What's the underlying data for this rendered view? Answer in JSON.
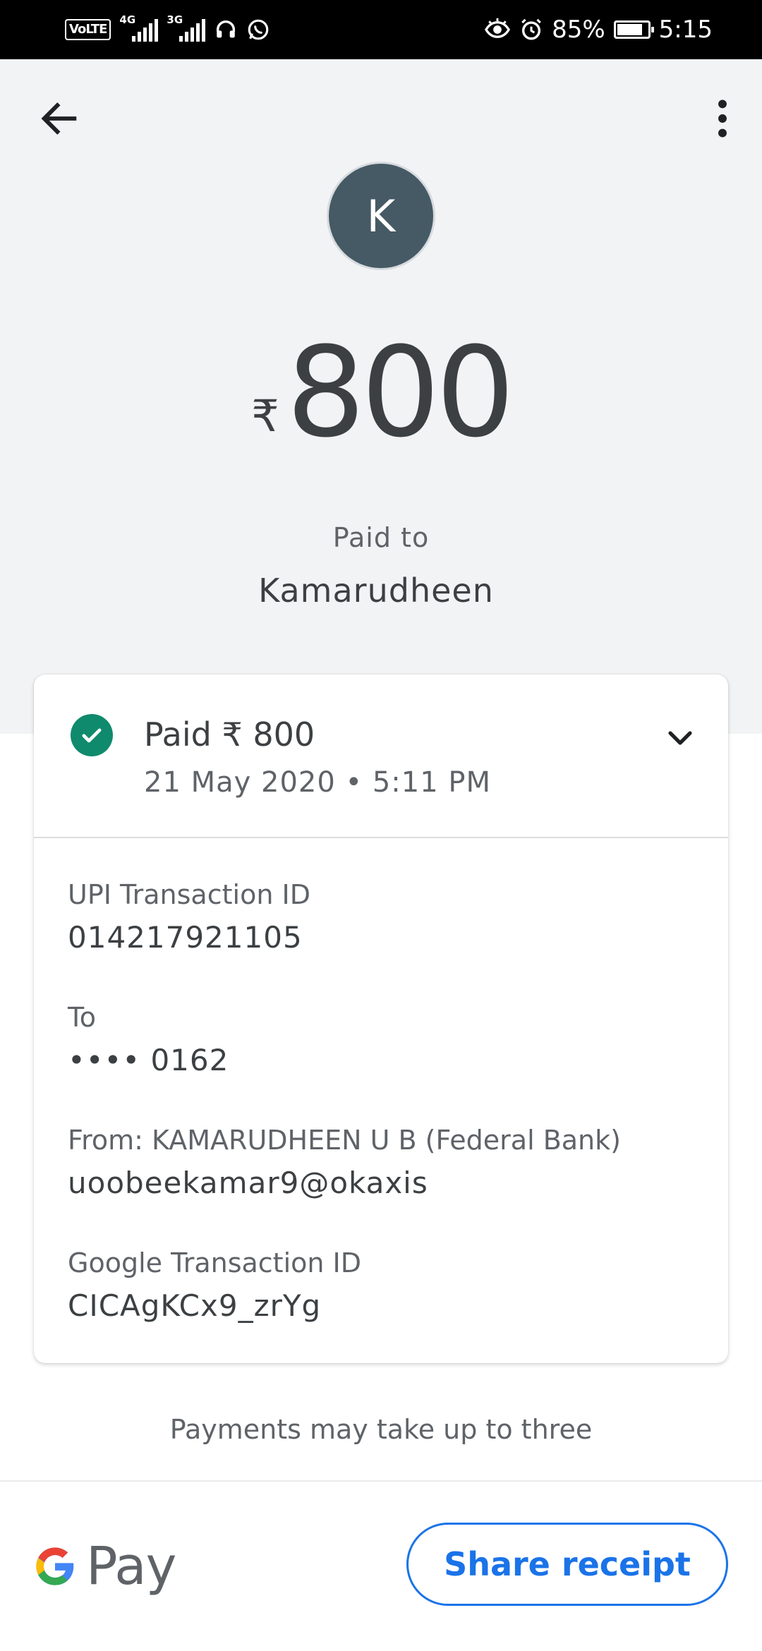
{
  "status_bar": {
    "volte": "VoLTE",
    "net1": "4G",
    "net2": "3G",
    "battery_pct": "85%",
    "battery_level": 0.85,
    "time": "5:15"
  },
  "header": {
    "avatar_letter": "K",
    "currency": "₹",
    "amount": "800",
    "paid_to_label": "Paid to",
    "payee_name": "Kamarudheen"
  },
  "status_card": {
    "paid_text": "Paid ₹ 800",
    "datetime": "21 May 2020 • 5:11 PM",
    "icon": "check-circle-icon",
    "status_color": "#0f8a6d"
  },
  "details": [
    {
      "label": "UPI Transaction ID",
      "value": "014217921105"
    },
    {
      "label": "To",
      "value": "•••• 0162"
    },
    {
      "label": "From: KAMARUDHEEN U B (Federal Bank)",
      "value": "uoobeekamar9@okaxis"
    },
    {
      "label": "Google Transaction ID",
      "value": "CICAgKCx9_zrYg"
    }
  ],
  "footer": {
    "note": "Payments may take up to three",
    "brand_text": "Pay",
    "share_label": "Share receipt",
    "accent": "#1a73e8"
  }
}
